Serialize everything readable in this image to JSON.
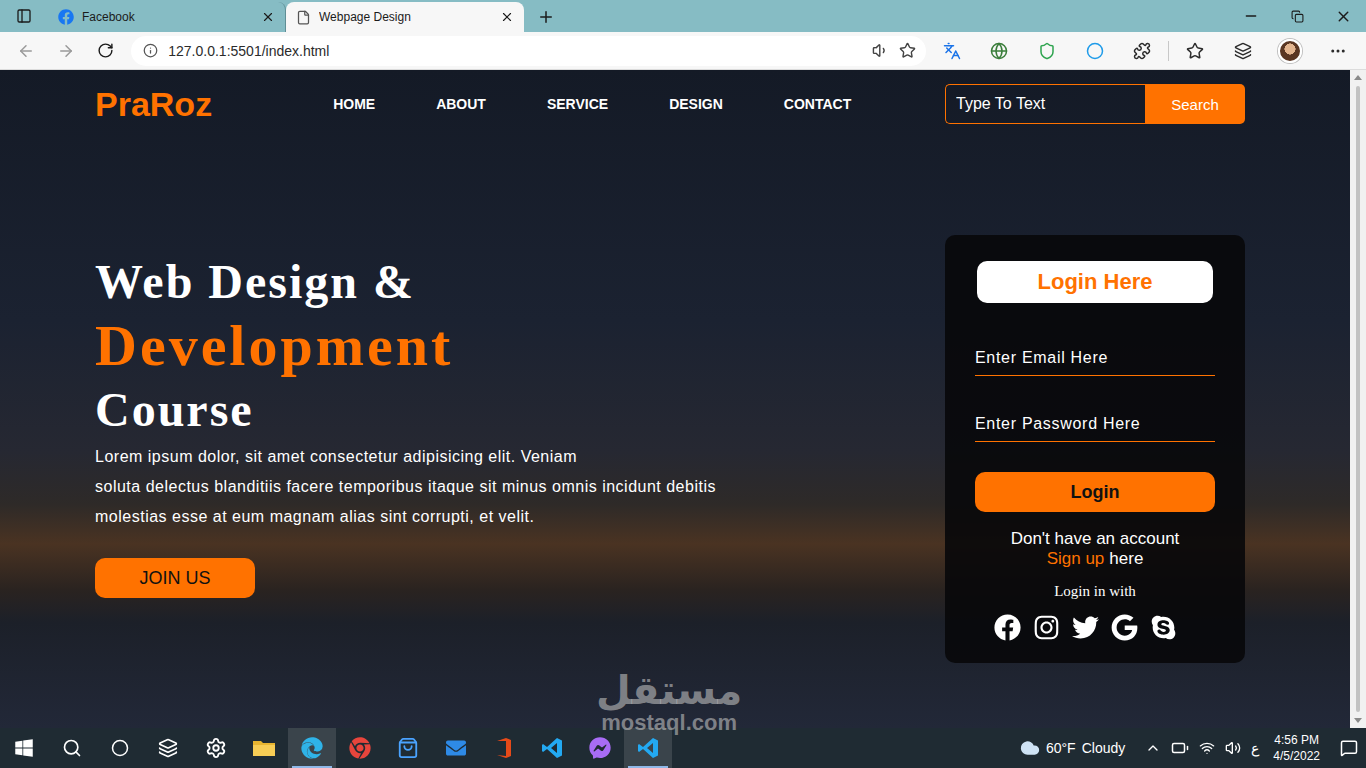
{
  "browser": {
    "tabs": [
      {
        "title": "Facebook",
        "kind": "facebook",
        "selected": false
      },
      {
        "title": "Webpage Design",
        "kind": "page",
        "selected": true
      }
    ],
    "address": "127.0.0.1:5501/index.html",
    "back_enabled": false,
    "forward_enabled": false
  },
  "page": {
    "logo": "PraRoz",
    "nav": [
      {
        "label": "HOME"
      },
      {
        "label": "ABOUT"
      },
      {
        "label": "SERVICE"
      },
      {
        "label": "DESIGN"
      },
      {
        "label": "CONTACT"
      }
    ],
    "search": {
      "placeholder": "Type To Text",
      "button": "Search"
    },
    "hero": {
      "line1": "Web Design &",
      "line2": "Development",
      "line3": "Course",
      "paragraph_lines": [
        "Lorem ipsum dolor, sit amet consectetur adipisicing elit. Veniam",
        "soluta delectus blanditiis facere temporibus itaque sit minus omnis incidunt debitis",
        "molestias esse at eum magnam alias sint corrupti, et velit."
      ],
      "button": "JOIN US"
    },
    "login": {
      "title": "Login Here",
      "email_placeholder": "Enter Email Here",
      "password_placeholder": "Enter Password Here",
      "button": "Login",
      "no_account": "Don't have an account",
      "signup_link": "Sign up",
      "signup_rest": "here",
      "social_title": "Login in with",
      "social": [
        {
          "kind": "facebook"
        },
        {
          "kind": "instagram"
        },
        {
          "kind": "twitter"
        },
        {
          "kind": "google"
        },
        {
          "kind": "skype"
        }
      ]
    }
  },
  "taskbar": {
    "apps": [
      {
        "kind": "settings",
        "active": false
      },
      {
        "kind": "explorer",
        "active": false
      },
      {
        "kind": "edge",
        "active": true
      },
      {
        "kind": "chrome",
        "active": false
      },
      {
        "kind": "store",
        "active": false
      },
      {
        "kind": "mail",
        "active": false
      },
      {
        "kind": "office",
        "active": false
      },
      {
        "kind": "vscode",
        "active": false
      },
      {
        "kind": "messenger",
        "active": false
      },
      {
        "kind": "vscode",
        "active": true
      }
    ],
    "weather": {
      "temp": "60°F",
      "condition": "Cloudy"
    },
    "language": "ع",
    "time": "4:56 PM",
    "date": "4/5/2022"
  },
  "watermark": {
    "name": "مستقل",
    "site": "mostaql.com"
  }
}
